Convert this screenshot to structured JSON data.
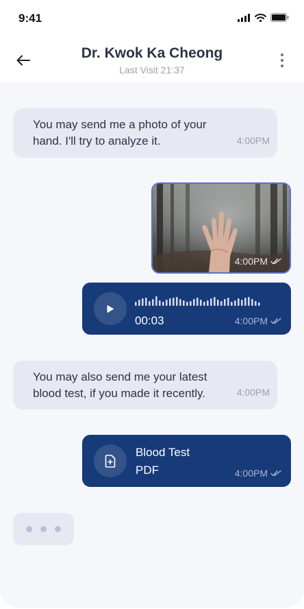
{
  "status_bar": {
    "time": "9:41",
    "icons": [
      "signal-icon",
      "wifi-icon",
      "battery-icon"
    ]
  },
  "header": {
    "back_icon": "arrow-left-icon",
    "title": "Dr. Kwok Ka Cheong",
    "subtitle": "Last Visit 21:37",
    "more_icon": "vertical-dots-icon"
  },
  "messages": [
    {
      "type": "text",
      "direction": "incoming",
      "text": "You may send me a photo of your\nhand. I'll try to analyze it.",
      "time": "4:00PM"
    },
    {
      "type": "image",
      "direction": "outgoing",
      "image": "hand-on-foggy-window-forest-photo",
      "time": "4:00PM",
      "status_icon": "double-check-icon"
    },
    {
      "type": "voice",
      "direction": "outgoing",
      "play_icon": "play-icon",
      "duration": "00:03",
      "time": "4:00PM",
      "status_icon": "double-check-icon"
    },
    {
      "type": "text",
      "direction": "incoming",
      "text": "You may also send me your latest\nblood test, if you made it recently.",
      "time": "4:00PM"
    },
    {
      "type": "file",
      "direction": "outgoing",
      "file_icon": "file-add-icon",
      "file_name": "Blood Test",
      "file_type": "PDF",
      "time": "4:00PM",
      "status_icon": "double-check-icon"
    }
  ],
  "typing_indicator": {
    "icon": "typing-dots-icon"
  },
  "colors": {
    "outgoing_bubble": "#173a78",
    "incoming_bubble": "#e6e9f1",
    "chat_background": "#f6f7fb",
    "photo_border": "#5b6fd0",
    "title_text": "#2b3346",
    "muted_text": "#9aa0ad"
  }
}
